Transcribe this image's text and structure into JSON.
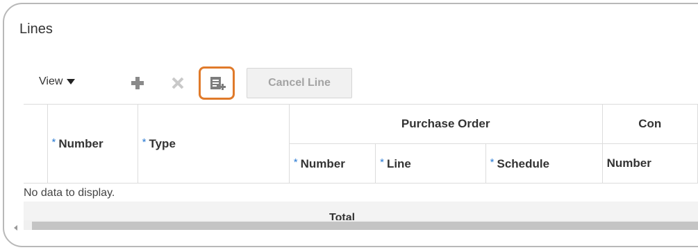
{
  "section": {
    "title": "Lines"
  },
  "toolbar": {
    "view_label": "View",
    "add_icon": "plus-icon",
    "delete_icon": "x-icon",
    "duplicate_icon": "duplicate-row-icon",
    "cancel_line_label": "Cancel Line",
    "highlight_color": "#e07a2a"
  },
  "table": {
    "required_marker": "*",
    "columns": {
      "number": "Number",
      "type": "Type",
      "purchase_order_group": "Purchase Order",
      "po_number": "Number",
      "po_line": "Line",
      "po_schedule": "Schedule",
      "con_group": "Con",
      "con_number": "Number"
    },
    "empty_message": "No data to display.",
    "totals_label": "Total"
  },
  "colors": {
    "required_marker": "#2b7bd3",
    "disabled_button_text": "#a3a3a3"
  }
}
